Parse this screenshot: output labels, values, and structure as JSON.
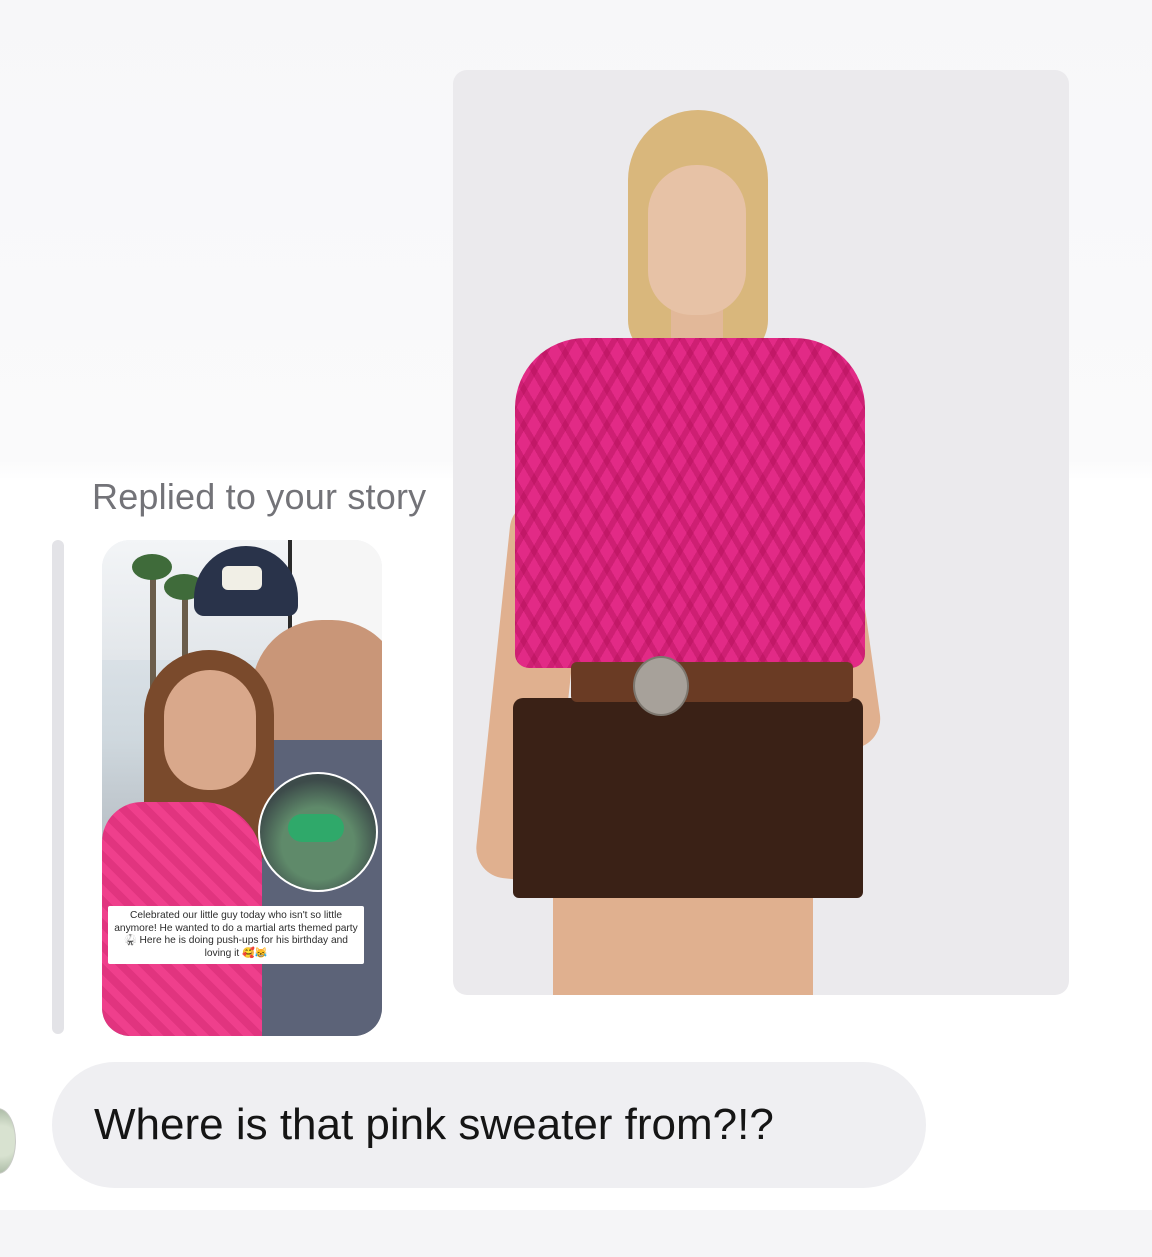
{
  "story_reply": {
    "label": "Replied to your story",
    "caption": "Celebrated our little guy today who isn't so little anymore! He wanted to do a martial arts themed party 🥋 Here he is doing push-ups for his birthday and loving it 🥰😹"
  },
  "message": {
    "text": "Where is that pink sweater from?!?"
  },
  "colors": {
    "bubble": "#efeff2",
    "label": "#737378",
    "sweater_pink": "#e22a86"
  }
}
